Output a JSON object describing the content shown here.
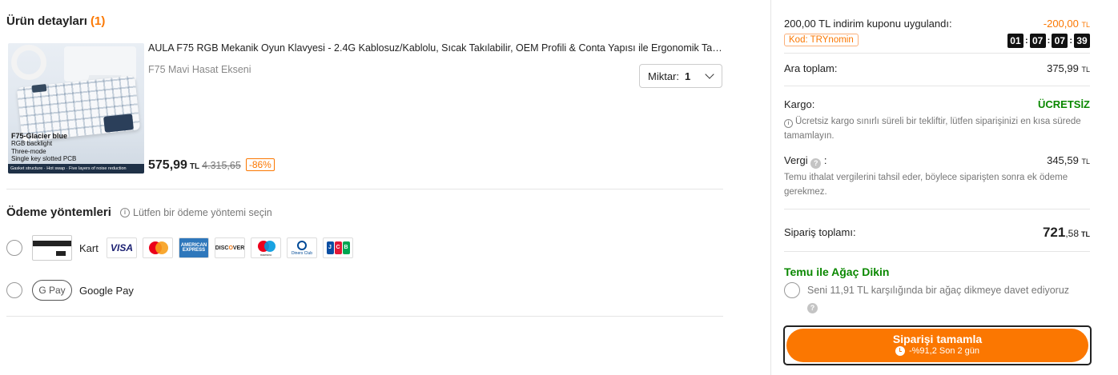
{
  "order": {
    "title": "Ürün detayları",
    "count_open": "(",
    "count": "1",
    "count_close": ")"
  },
  "product": {
    "image_text": {
      "model": "F75",
      "variant": "-Glacier blue",
      "features": [
        "RGB backlight",
        "Three-mode",
        "Single key slotted PCB"
      ],
      "strip": "Gasket structure · Hot swap · Five layers of noise reduction"
    },
    "title": "AULA F75 RGB Mekanik Oyun Klavyesi - 2.4G Kablosuz/Kablolu, Sıcak Takılabilir, OEM Profili & Conta Yapısı ile Ergonomik Tasarım",
    "variant": "F75 Mavi Hasat Ekseni",
    "quantity_label": "Miktar:",
    "quantity_value": "1",
    "price": "575,99",
    "currency": "TL",
    "old_price": "4.315,65",
    "discount": "-86%"
  },
  "payment": {
    "title": "Ödeme yöntemleri",
    "hint": "Lütfen bir ödeme yöntemi seçin",
    "card_label": "Kart",
    "card_brands": [
      "VISA",
      "Mastercard",
      "American Express",
      "DISCOVER",
      "Maestro",
      "Diners Club",
      "JCB"
    ],
    "gpay_badge": "G Pay",
    "gpay_label": "Google Pay"
  },
  "summary": {
    "coupon_label": "200,00 TL indirim kuponu uygulandı:",
    "coupon_value": "-200,00",
    "coupon_currency": "TL",
    "coupon_code": "Kod: TRYnomin",
    "timer": [
      "01",
      "07",
      "07",
      "39"
    ],
    "subtotal_label": "Ara toplam:",
    "subtotal_value": "375,99",
    "subtotal_currency": "TL",
    "shipping_label": "Kargo:",
    "shipping_value": "ÜCRETSİZ",
    "shipping_note": "Ücretsiz kargo sınırlı süreli bir tekliftir, lütfen siparişinizi en kısa sürede tamamlayın.",
    "tax_label": "Vergi",
    "tax_colon": ":",
    "tax_value": "345,59",
    "tax_currency": "TL",
    "tax_note": "Temu ithalat vergilerini tahsil eder, böylece siparişten sonra ek ödeme gerekmez.",
    "total_label": "Sipariş toplamı:",
    "total_int": "721",
    "total_dec": ",58",
    "total_currency": "TL",
    "tree_title": "Temu ile Ağaç Dikin",
    "tree_text": "Seni 11,91 TL karşılığında bir ağaç dikmeye davet ediyoruz",
    "cta_label": "Siparişi tamamla",
    "cta_sub": "-%91,2 Son 2 gün"
  },
  "colors": {
    "accent": "#fb7701",
    "success": "#0a8800",
    "text": "#222222",
    "muted": "#777777"
  }
}
